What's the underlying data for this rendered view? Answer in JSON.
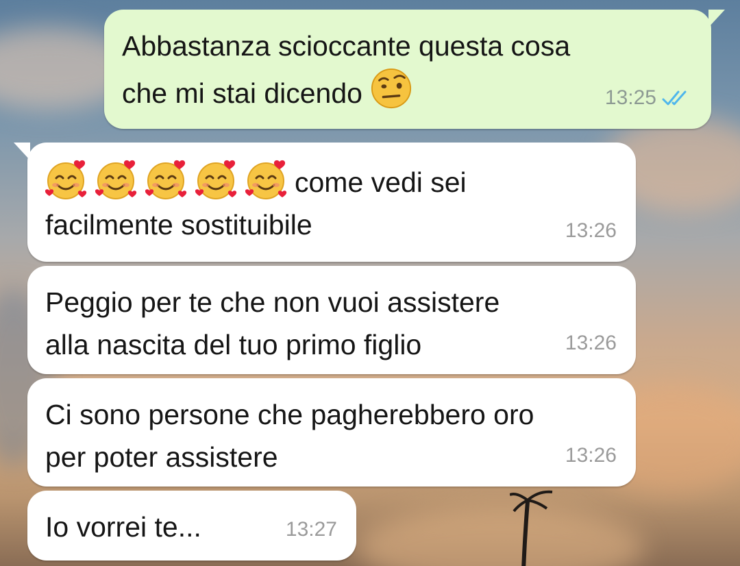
{
  "chat": {
    "messages": [
      {
        "direction": "outgoing",
        "lines": [
          "Abbastanza scioccante questa cosa",
          "che mi stai dicendo"
        ],
        "emoji": "face-with-raised-eyebrow-icon",
        "time": "13:25",
        "status": "read"
      },
      {
        "direction": "incoming",
        "emoji_prefix": [
          "smiling-face-with-hearts-icon",
          "smiling-face-with-hearts-icon",
          "smiling-face-with-hearts-icon",
          "smiling-face-with-hearts-icon",
          "smiling-face-with-hearts-icon"
        ],
        "lines": [
          "come vedi sei",
          "facilmente sostituibile"
        ],
        "time": "13:26"
      },
      {
        "direction": "incoming",
        "lines": [
          "Peggio per te che non vuoi assistere",
          "alla nascita del tuo primo figlio"
        ],
        "time": "13:26"
      },
      {
        "direction": "incoming",
        "lines": [
          "Ci sono persone che pagherebbero oro",
          "per poter assistere"
        ],
        "time": "13:26"
      },
      {
        "direction": "incoming",
        "lines": [
          "Io vorrei te..."
        ],
        "time": "13:27"
      }
    ]
  },
  "colors": {
    "outgoing_bubble": "#e3f9cf",
    "incoming_bubble": "#ffffff",
    "read_ticks": "#4fb6ec",
    "timestamp": "#8d9a93"
  }
}
